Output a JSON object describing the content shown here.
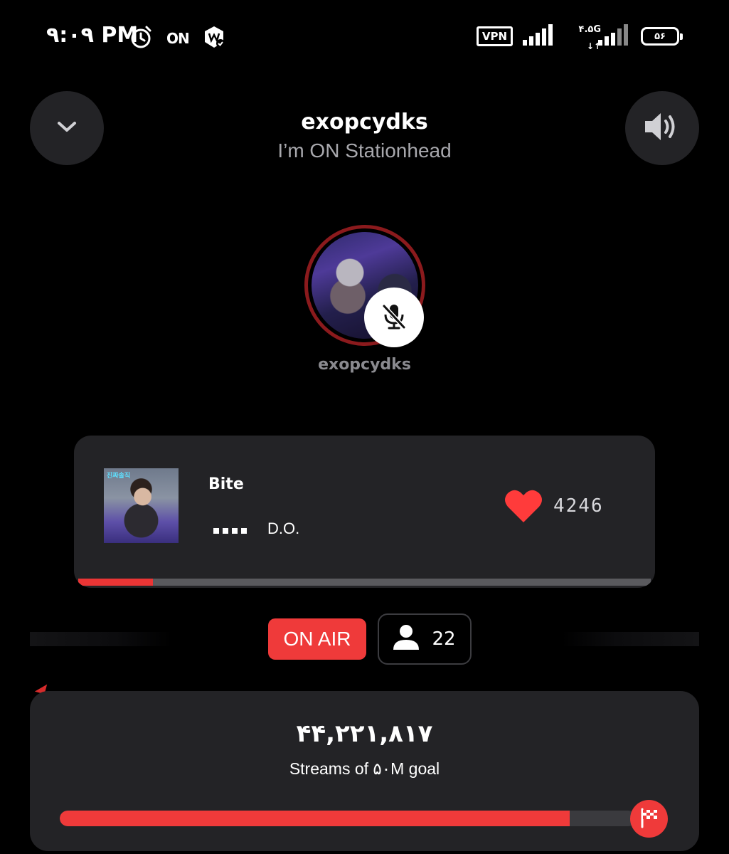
{
  "status_bar": {
    "time": "۹:۰۹ PM",
    "on_label": "ON",
    "vpn_label": "VPN",
    "network_label": "۴.۵G",
    "network_arrows": "↓↑",
    "battery": "۵۶",
    "icons": [
      "alarm-icon",
      "on-icon",
      "app-badge-icon",
      "signal-icon",
      "battery-icon"
    ]
  },
  "header": {
    "title": "exopcydks",
    "subtitle": "I’m ON Stationhead",
    "collapse_icon": "chevron-down-icon",
    "volume_icon": "volume-icon"
  },
  "host": {
    "name": "exopcydks",
    "muted": true,
    "ring_color": "#8b1a1d"
  },
  "now_playing": {
    "album_tag": "진짜솔직",
    "title": "Bite",
    "artist": "D.O.",
    "likes": "4246",
    "progress_fraction": 0.13,
    "like_color": "#ff3b3b"
  },
  "broadcast": {
    "on_air_label": "ON AIR",
    "listener_count": "22",
    "accent": "#ef3a3a"
  },
  "goal": {
    "streams": "۴۴,۲۲۱,۸۱۷",
    "label": "Streams of ۵۰M goal",
    "progress_fraction": 0.885
  }
}
